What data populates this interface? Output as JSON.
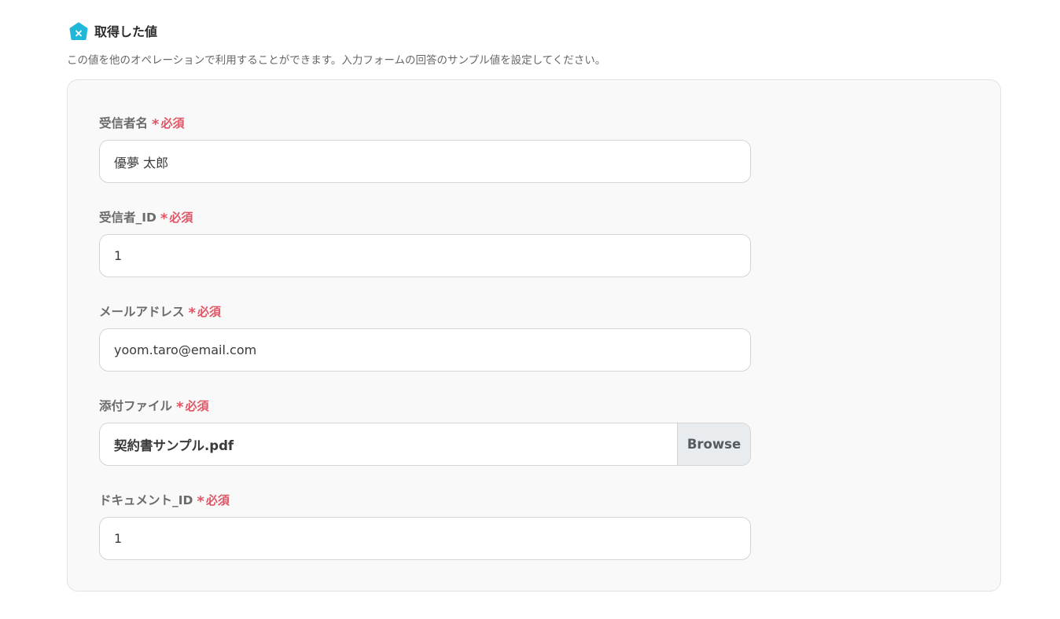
{
  "header": {
    "icon": "hexagon-x-icon",
    "title": "取得した値",
    "accent_color": "#1fb8d8"
  },
  "description": "この値を他のオペレーションで利用することができます。入力フォームの回答のサンプル値を設定してください。",
  "required_color": "#e05565",
  "fields": [
    {
      "label": "受信者名",
      "required_mark": "*",
      "required_text": "必須",
      "value": "優夢 太郎"
    },
    {
      "label": "受信者_ID",
      "required_mark": "*",
      "required_text": "必須",
      "value": "1"
    },
    {
      "label": "メールアドレス",
      "required_mark": "*",
      "required_text": "必須",
      "value": "yoom.taro@email.com"
    },
    {
      "label": "添付ファイル",
      "required_mark": "*",
      "required_text": "必須",
      "value": "契約書サンプル.pdf",
      "button_label": "Browse"
    },
    {
      "label": "ドキュメント_ID",
      "required_mark": "*",
      "required_text": "必須",
      "value": "1"
    }
  ]
}
